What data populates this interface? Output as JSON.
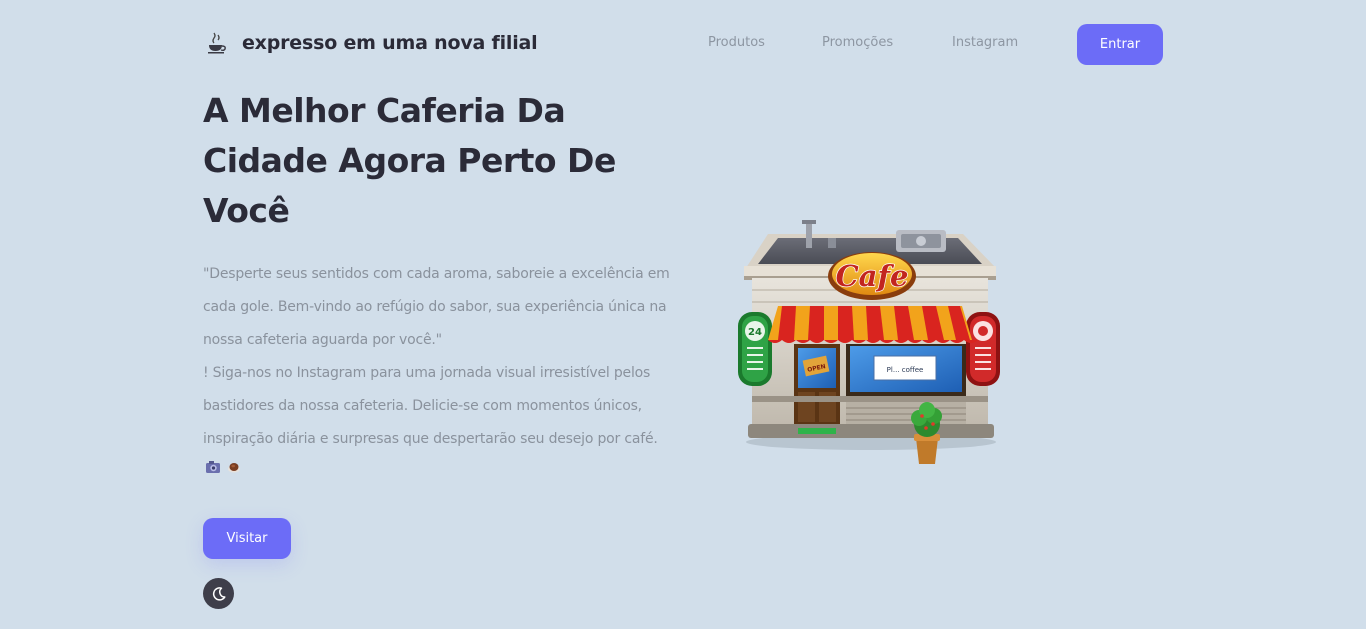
{
  "header": {
    "brand": "expresso em uma nova filial",
    "nav": [
      "Produtos",
      "Promoções",
      "Instagram"
    ],
    "login_label": "Entrar"
  },
  "hero": {
    "title": "A Melhor Caferia Da Cidade Agora Perto De Você",
    "description_1": "\"Desperte seus sentidos com cada aroma, saboreie a excelência em cada gole. Bem-vindo ao refúgio do sabor, sua experiência única na nossa cafeteria aguarda por você.\"",
    "description_2": "! Siga-nos no Instagram para uma jornada visual irresistível pelos bastidores da nossa cafeteria. Delicie-se com momentos únicos, inspiração diária e surpresas que despertarão seu desejo por café.",
    "visit_label": "Visitar"
  },
  "illustration": {
    "sign_text": "Cafe",
    "badge_24": "24",
    "door_sign": "OPEN",
    "window_sign": "Pl... coffee"
  },
  "colors": {
    "background": "#d1deea",
    "accent": "#6c6cf7",
    "text_dark": "#2b2b38",
    "text_muted": "#8a929d"
  }
}
